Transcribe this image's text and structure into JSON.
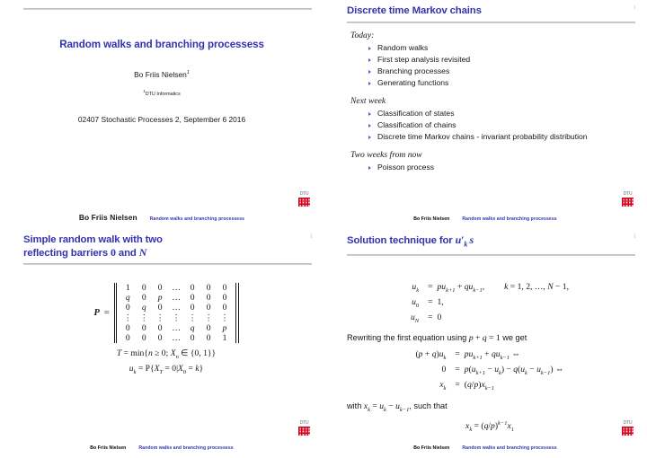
{
  "deck": {
    "footer_author": "Bo Friis Nielsen",
    "footer_subject": "Random walks and branching processess",
    "logo_word": "DTU",
    "page_mark": "1"
  },
  "slide1": {
    "main_title": "Random walks and branching processess",
    "author": "Bo Friis Nielsen",
    "author_footnote_marker": "1",
    "affiliation": "DTU Informatics",
    "affiliation_marker": "1",
    "course": "02407 Stochastic Processes 2, September 6 2016"
  },
  "slide2": {
    "title": "Discrete time Markov chains",
    "groups": [
      {
        "label": "Today:",
        "items": [
          "Random walks",
          "First step analysis revisited",
          "Branching processes",
          "Generating functions"
        ]
      },
      {
        "label": "Next week",
        "items": [
          "Classification of states",
          "Classification of chains",
          "Discrete time Markov chains - invariant probability distribution"
        ]
      },
      {
        "label": "Two weeks from now",
        "items": [
          "Poisson process"
        ]
      }
    ]
  },
  "slide3": {
    "title_line1": "Simple random walk with two",
    "title_line2_pre": "reflecting barriers ",
    "title_zero": "0",
    "title_and": " and ",
    "title_N": "N",
    "matrix_label": "P",
    "matrix_eq": "=",
    "matrix_rows": [
      [
        "1",
        "0",
        "0",
        "…",
        "0",
        "0",
        "0"
      ],
      [
        "q",
        "0",
        "p",
        "…",
        "0",
        "0",
        "0"
      ],
      [
        "0",
        "q",
        "0",
        "…",
        "0",
        "0",
        "0"
      ],
      [
        "⋮",
        "⋮",
        "⋮",
        "⋮",
        "⋮",
        "⋮",
        "⋮"
      ],
      [
        "0",
        "0",
        "0",
        "…",
        "q",
        "0",
        "p"
      ],
      [
        "0",
        "0",
        "0",
        "…",
        "0",
        "0",
        "1"
      ]
    ],
    "eq_T": "T = min{n ≥ 0; Xn ∈ {0, 1}}",
    "eq_u": "uk = P{XT = 0|X0 = k}"
  },
  "slide4": {
    "title_pre": "Solution technique for ",
    "title_math": "u'k s",
    "system": [
      {
        "lhs": "uk",
        "rel": "=",
        "rhs": "puk+1 + quk−1,",
        "cond": "k = 1, 2, …, N − 1,"
      },
      {
        "lhs": "u0",
        "rel": "=",
        "rhs": "1,",
        "cond": ""
      },
      {
        "lhs": "uN",
        "rel": "=",
        "rhs": "0",
        "cond": ""
      }
    ],
    "prose1_a": "Rewriting the first equation using ",
    "prose1_math": "p + q = 1",
    "prose1_b": " we get",
    "derivation": [
      {
        "lhs": "(p + q)uk",
        "rel": "=",
        "rhs": "puk+1 + quk−1 ⇔"
      },
      {
        "lhs": "0",
        "rel": "=",
        "rhs": "p(uk+1 − uk) − q(uk − uk−1) ⇔"
      },
      {
        "lhs": "xk",
        "rel": "=",
        "rhs": "(q/p)xk−1"
      }
    ],
    "prose2_a": "with ",
    "prose2_math": "xk = uk − uk−1",
    "prose2_b": ", such that",
    "final_eq": "xk = (q/p)k−1x1"
  }
}
